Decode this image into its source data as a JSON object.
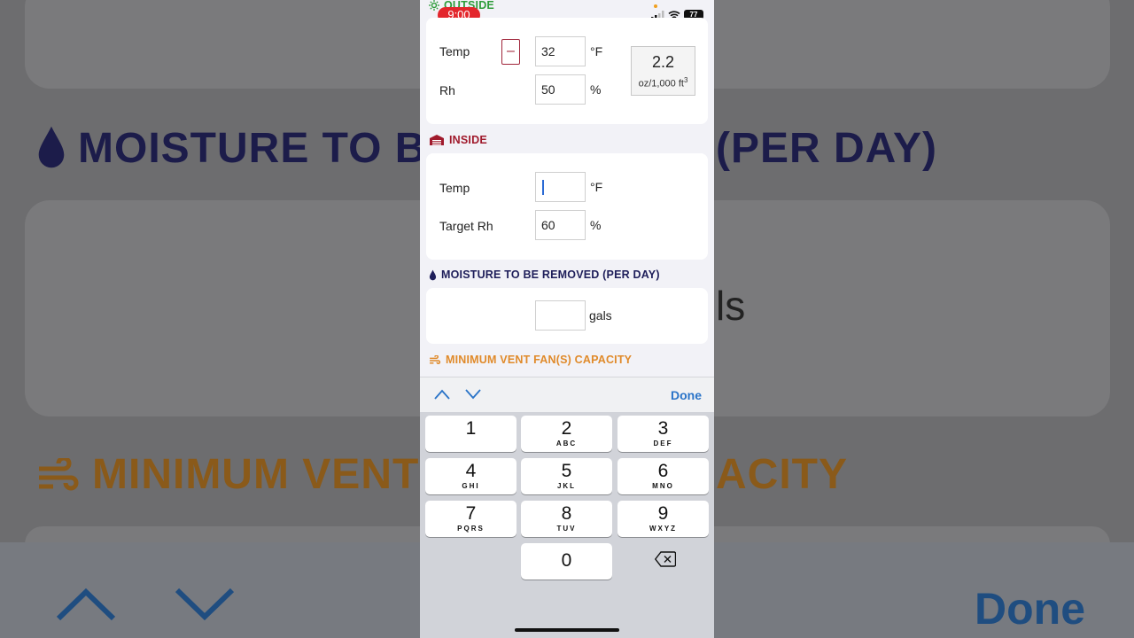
{
  "background": {
    "moisture_title_left": "MOISTURE TO B",
    "moisture_title_right": "(PER DAY)",
    "gals_fragment": "ls",
    "vent_title_left": "MINIMUM VENT",
    "vent_title_right": "ACITY",
    "done_label": "Done"
  },
  "status_bar": {
    "time": "9:00",
    "battery": "77"
  },
  "outside": {
    "title": "OUTSIDE",
    "temp_label": "Temp",
    "temp_value": "32",
    "temp_unit": "°F",
    "minus_label": "–",
    "rh_label": "Rh",
    "rh_value": "50",
    "rh_unit": "%",
    "result_value": "2.2",
    "result_unit": "oz/1,000 ft",
    "result_unit_sup": "3"
  },
  "inside": {
    "title": "INSIDE",
    "temp_label": "Temp",
    "temp_value": "",
    "temp_unit": "°F",
    "rh_label": "Target Rh",
    "rh_value": "60",
    "rh_unit": "%"
  },
  "moisture": {
    "title": "MOISTURE TO BE REMOVED (PER DAY)",
    "value": "",
    "unit": "gals"
  },
  "vent": {
    "title": "MINIMUM VENT FAN(S) CAPACITY"
  },
  "keyboard": {
    "done_label": "Done",
    "keys": [
      {
        "n": "1",
        "l": ""
      },
      {
        "n": "2",
        "l": "ABC"
      },
      {
        "n": "3",
        "l": "DEF"
      },
      {
        "n": "4",
        "l": "GHI"
      },
      {
        "n": "5",
        "l": "JKL"
      },
      {
        "n": "6",
        "l": "MNO"
      },
      {
        "n": "7",
        "l": "PQRS"
      },
      {
        "n": "8",
        "l": "TUV"
      },
      {
        "n": "9",
        "l": "WXYZ"
      },
      {
        "n": "0",
        "l": ""
      }
    ]
  },
  "colors": {
    "outside_green": "#2e9c3a",
    "inside_red": "#a01a2c",
    "moisture_navy": "#1e1e5a",
    "vent_orange": "#e08a2a",
    "done_blue": "#2a74c8"
  }
}
